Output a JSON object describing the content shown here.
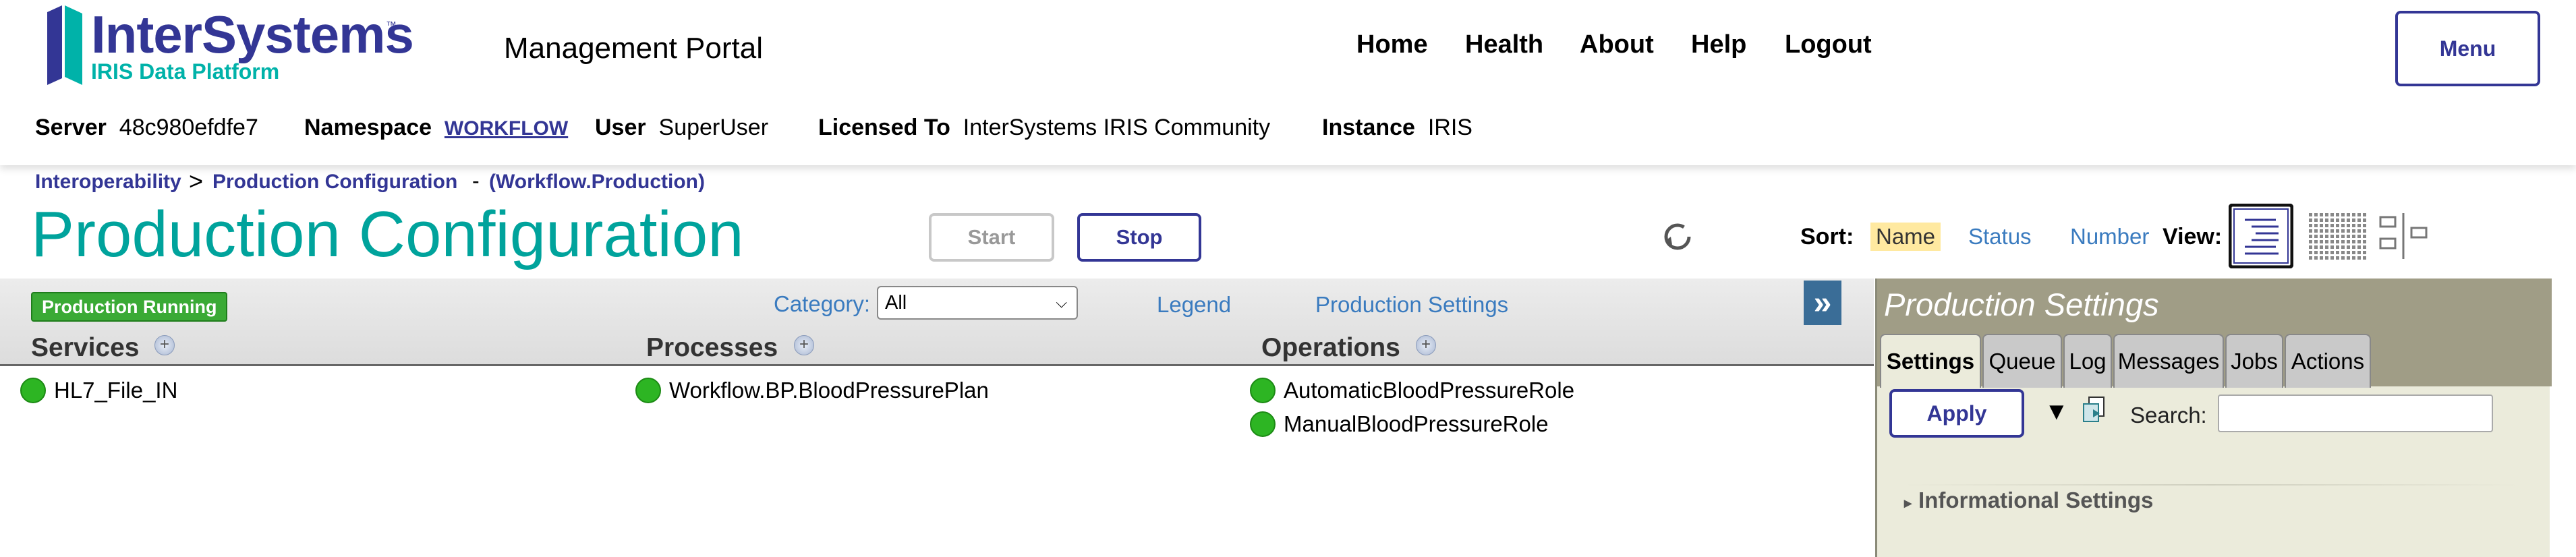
{
  "header": {
    "logo_name": "InterSystems",
    "logo_tm": "™",
    "logo_sub": "IRIS Data Platform",
    "portal_title": "Management Portal",
    "nav": [
      "Home",
      "Health",
      "About",
      "Help",
      "Logout"
    ],
    "menu_label": "Menu"
  },
  "info": {
    "server_label": "Server",
    "server_value": "48c980efdfe7",
    "namespace_label": "Namespace",
    "namespace_value": "WORKFLOW",
    "user_label": "User",
    "user_value": "SuperUser",
    "licensed_label": "Licensed To",
    "licensed_value": "InterSystems IRIS Community",
    "instance_label": "Instance",
    "instance_value": "IRIS"
  },
  "breadcrumb": {
    "items": [
      "Interoperability",
      "Production Configuration"
    ],
    "separator": ">",
    "suffix": "(Workflow.Production)",
    "dash": "-"
  },
  "page_title": "Production Configuration",
  "actions": {
    "start": "Start",
    "stop": "Stop"
  },
  "sort": {
    "label": "Sort:",
    "options": [
      "Name",
      "Status",
      "Number"
    ],
    "selected": "Name"
  },
  "view": {
    "label": "View:"
  },
  "toolbar": {
    "status_badge": "Production Running",
    "category_label": "Category:",
    "category_value": "All",
    "legend": "Legend",
    "production_settings": "Production Settings",
    "expand": "»"
  },
  "columns": {
    "services": {
      "title": "Services",
      "items": [
        "HL7_File_IN"
      ]
    },
    "processes": {
      "title": "Processes",
      "items": [
        "Workflow.BP.BloodPressurePlan"
      ]
    },
    "operations": {
      "title": "Operations",
      "items": [
        "AutomaticBloodPressureRole",
        "ManualBloodPressureRole"
      ]
    }
  },
  "panel": {
    "title": "Production Settings",
    "tabs": [
      "Settings",
      "Queue",
      "Log",
      "Messages",
      "Jobs",
      "Actions"
    ],
    "active_tab": "Settings",
    "apply": "Apply",
    "search_label": "Search:",
    "search_value": "",
    "section": "Informational Settings"
  },
  "colors": {
    "brand_navy": "#333695",
    "brand_teal": "#00a39c",
    "status_green": "#2db523",
    "link_blue": "#3a7bbf",
    "panel_header": "#a09d86"
  },
  "icons": [
    "intersystems-logo-icon",
    "refresh-icon",
    "view-list-icon",
    "view-grid-icon",
    "view-columns-icon",
    "add-icon",
    "status-dot-icon",
    "dropdown-arrow-icon",
    "copy-icon",
    "expand-icon"
  ]
}
